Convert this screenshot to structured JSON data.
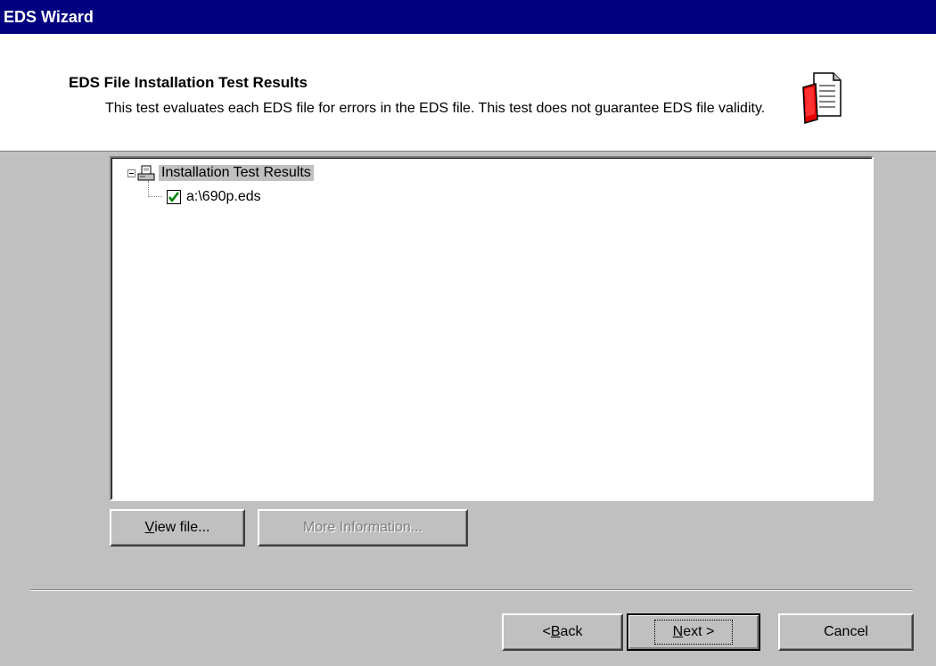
{
  "window": {
    "title": "EDS Wizard"
  },
  "header": {
    "title": "EDS File Installation Test Results",
    "description": "This test evaluates each EDS file for errors in the EDS file. This test does not guarantee EDS file validity.",
    "icon": "document-book-icon"
  },
  "tree": {
    "root": {
      "label": "Installation Test Results",
      "icon": "computer-document-icon",
      "expanded": true
    },
    "children": [
      {
        "label": "a:\\690p.eds",
        "icon": "green-check-icon",
        "checked": true
      }
    ]
  },
  "buttons": {
    "view_file": {
      "label_pre": "",
      "label_underlined": "V",
      "label_post": "iew file..."
    },
    "more_information": {
      "label": "More Information..."
    },
    "back": {
      "label_pre": "< ",
      "label_underlined": "B",
      "label_post": "ack"
    },
    "next": {
      "label_pre": "",
      "label_underlined": "N",
      "label_post": "ext >"
    },
    "cancel": {
      "label": "Cancel"
    }
  },
  "colors": {
    "titlebar": "#000080",
    "face": "#c0c0c0",
    "check": "#008000"
  }
}
